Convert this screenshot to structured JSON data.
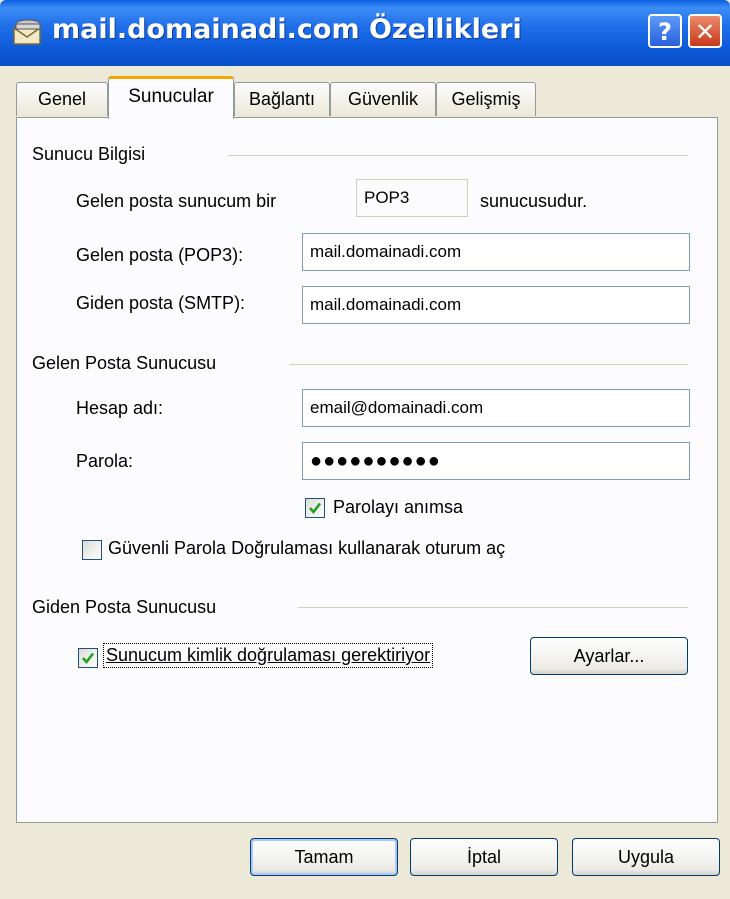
{
  "window": {
    "title": "mail.domainadi.com Özellikleri",
    "help_label": "?",
    "close_label": "✕"
  },
  "tabs": [
    {
      "label": "Genel"
    },
    {
      "label": "Sunucular"
    },
    {
      "label": "Bağlantı"
    },
    {
      "label": "Güvenlik"
    },
    {
      "label": "Gelişmiş"
    }
  ],
  "server_info": {
    "section": "Sunucu Bilgisi",
    "incoming_type_prefix": "Gelen posta sunucum bir",
    "incoming_type_value": "POP3",
    "incoming_type_suffix": "sunucusudur.",
    "incoming_label": "Gelen posta (POP3):",
    "incoming_value": "mail.domainadi.com",
    "outgoing_label": "Giden posta (SMTP):",
    "outgoing_value": "mail.domainadi.com"
  },
  "incoming_server": {
    "section": "Gelen Posta Sunucusu",
    "account_label": "Hesap adı:",
    "account_value": "email@domainadi.com",
    "password_label": "Parola:",
    "password_value": "●●●●●●●●●●",
    "remember_label": "Parolayı anımsa",
    "remember_checked": true,
    "spa_label": "Güvenli Parola Doğrulaması kullanarak oturum aç",
    "spa_checked": false
  },
  "outgoing_server": {
    "section": "Giden Posta Sunucusu",
    "auth_label": "Sunucum kimlik doğrulaması gerektiriyor",
    "auth_checked": true,
    "settings_label": "Ayarlar..."
  },
  "footer": {
    "ok_label": "Tamam",
    "cancel_label": "İptal",
    "apply_label": "Uygula"
  },
  "colors": {
    "title_bar": "#0a5ee0",
    "face": "#ece9d8",
    "panel": "#fcfcfe",
    "tab_highlight": "#f4a300",
    "check": "#21a121"
  }
}
